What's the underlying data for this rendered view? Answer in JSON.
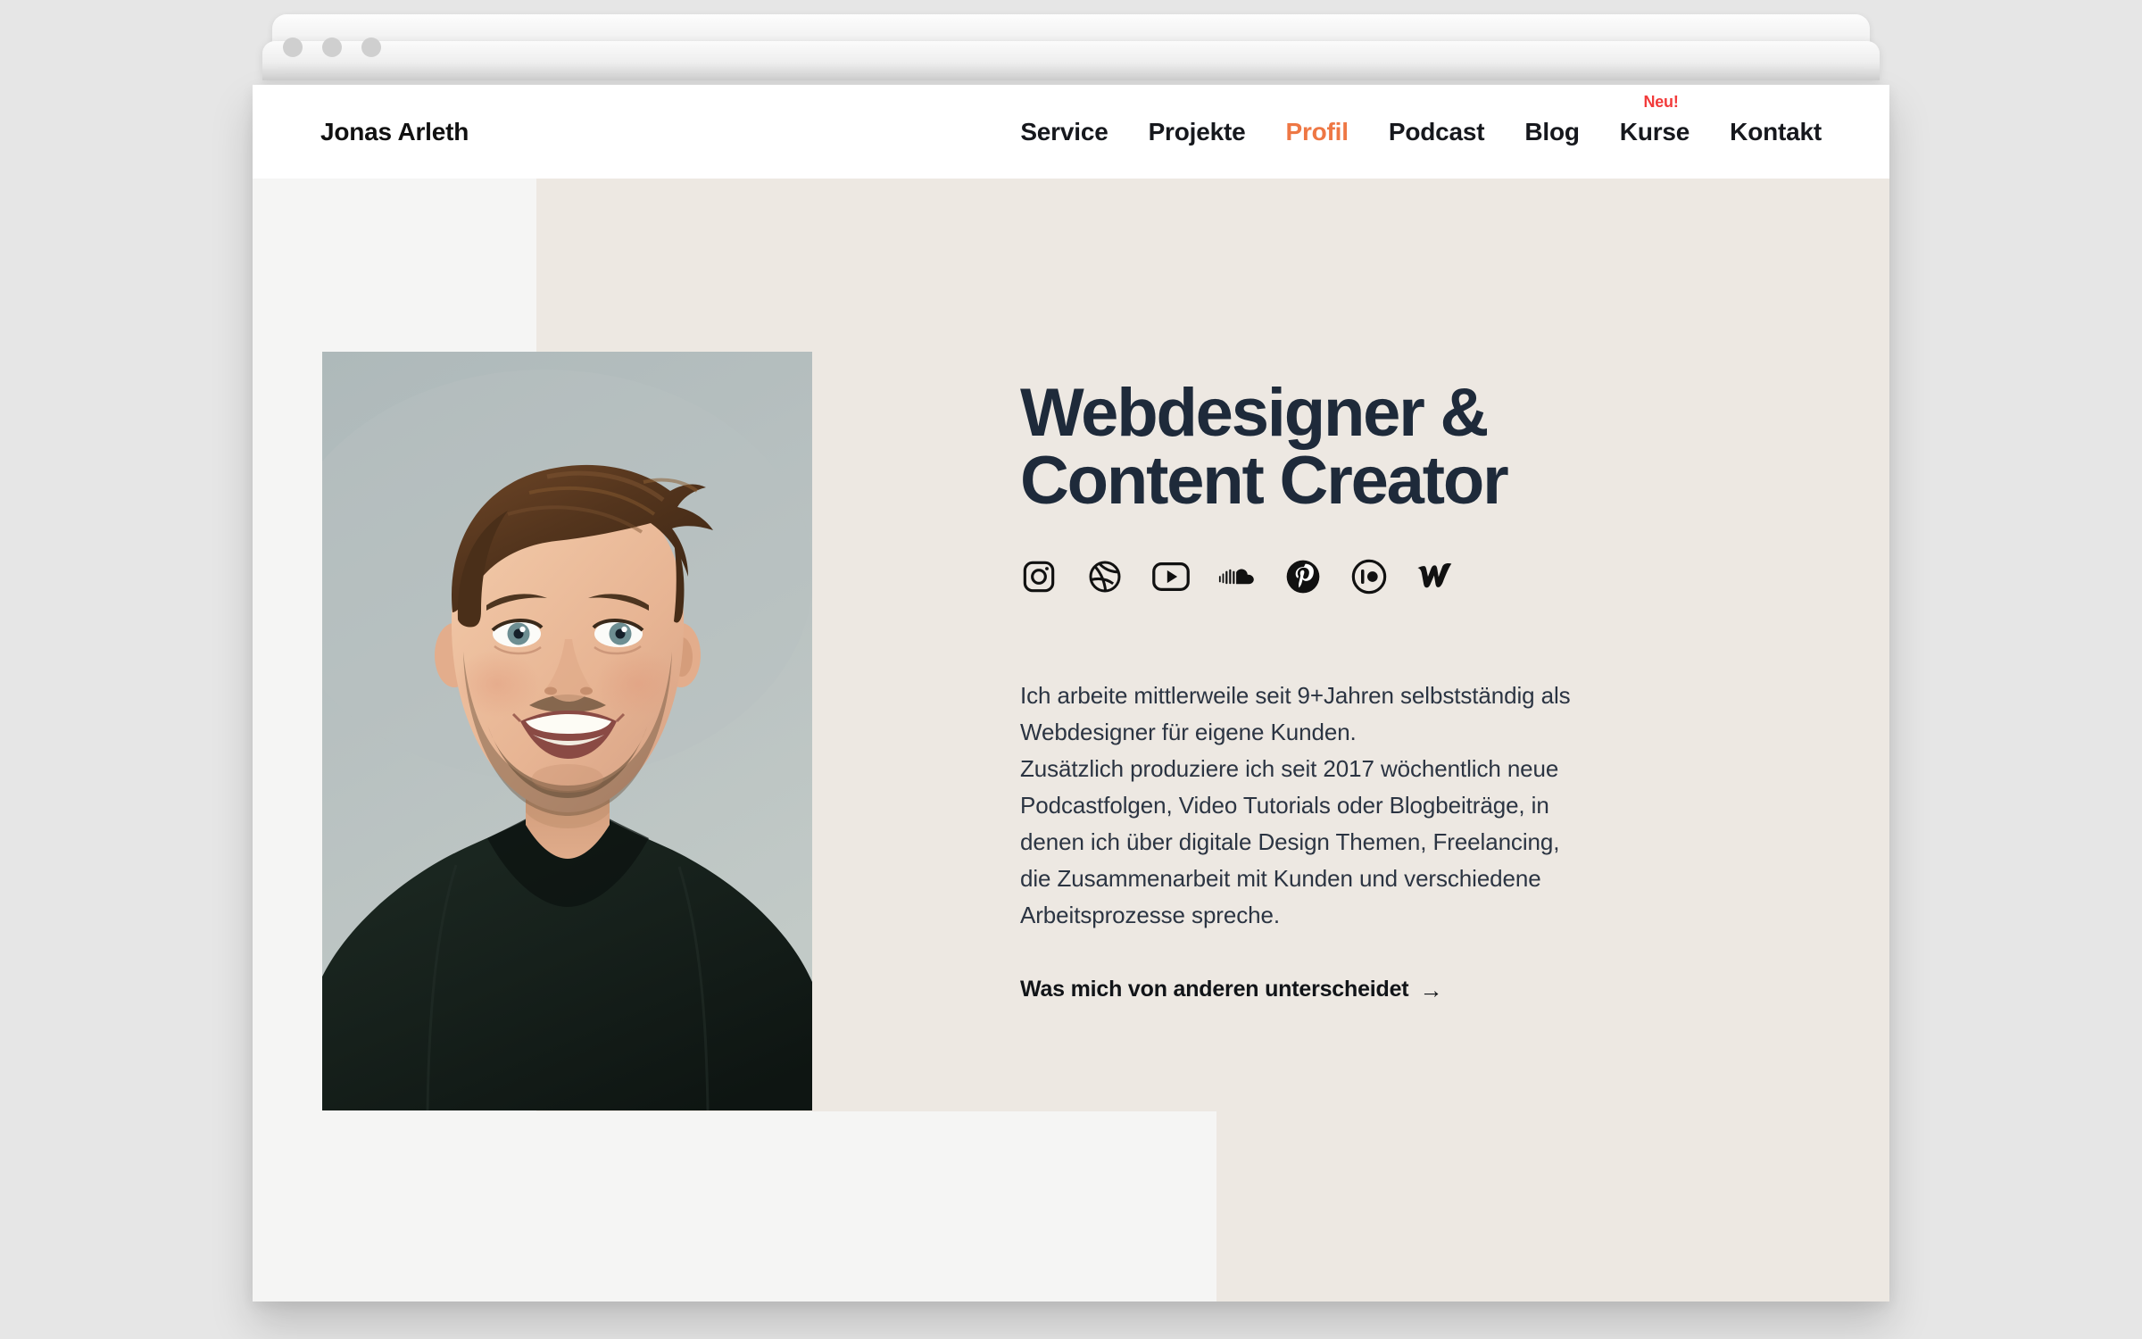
{
  "window": {
    "dots": [
      "window-dot-1",
      "window-dot-2",
      "window-dot-3"
    ]
  },
  "header": {
    "logo": "Jonas Arleth",
    "nav": [
      {
        "label": "Service",
        "active": false,
        "badge": null
      },
      {
        "label": "Projekte",
        "active": false,
        "badge": null
      },
      {
        "label": "Profil",
        "active": true,
        "badge": null
      },
      {
        "label": "Podcast",
        "active": false,
        "badge": null
      },
      {
        "label": "Blog",
        "active": false,
        "badge": null
      },
      {
        "label": "Kurse",
        "active": false,
        "badge": "Neu!"
      },
      {
        "label": "Kontakt",
        "active": false,
        "badge": null
      }
    ]
  },
  "hero": {
    "title_line_1": "Webdesigner &",
    "title_line_2": "Content Creator",
    "paragraph": "Ich arbeite mittlerweile seit 9+Jahren selbstständig als Webdesigner für eigene Kunden. Zusätzlich produziere ich seit 2017 wöchentlich neue Podcastfolgen, Video Tutorials oder Blogbeiträge, in denen ich über digitale Design Themen, Freelancing, die Zusammenarbeit mit Kunden und verschiedene Arbeitsprozesse spreche.",
    "paragraph_lines": [
      "Ich arbeite mittlerweile seit 9+Jahren selbstständig als",
      "Webdesigner für eigene Kunden.",
      "Zusätzlich produziere ich seit 2017 wöchentlich neue",
      "Podcastfolgen, Video Tutorials oder Blogbeiträge, in",
      "denen ich über digitale Design Themen, Freelancing,",
      "die Zusammenarbeit mit Kunden und verschiedene",
      "Arbeitsprozesse spreche."
    ],
    "cta_label": "Was mich von anderen unterscheidet",
    "cta_arrow": "→",
    "socials": [
      {
        "name": "instagram-icon",
        "label": "Instagram"
      },
      {
        "name": "dribbble-icon",
        "label": "Dribbble"
      },
      {
        "name": "youtube-icon",
        "label": "YouTube"
      },
      {
        "name": "soundcloud-icon",
        "label": "SoundCloud"
      },
      {
        "name": "pinterest-icon",
        "label": "Pinterest"
      },
      {
        "name": "patreon-icon",
        "label": "Patreon"
      },
      {
        "name": "webflow-icon",
        "label": "Webflow"
      }
    ]
  },
  "portrait": {
    "alt": "Portrait photo of a smiling man with brown swept-back hair and short beard wearing a dark green sweater"
  },
  "colors": {
    "accent_orange": "#ee7744",
    "badge_red": "#f23b3b",
    "heading_navy": "#1e2a3a",
    "panel_beige": "#ede8e2",
    "panel_light": "#f5f5f4",
    "page_background": "#e6e6e6",
    "header_white": "#ffffff",
    "photo_backdrop": "#b5bfc0",
    "sweater_dark": "#161f1b"
  }
}
